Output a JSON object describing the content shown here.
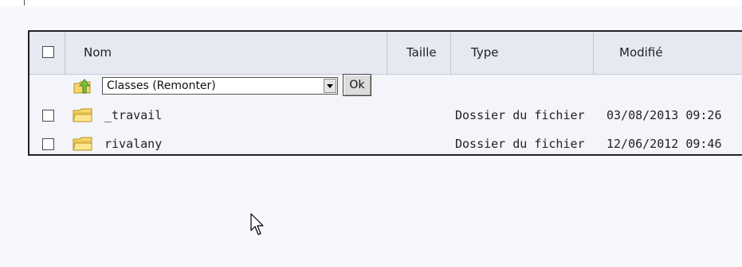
{
  "header": {
    "name_label": "Nom",
    "size_label": "Taille",
    "type_label": "Type",
    "modified_label": "Modifié"
  },
  "nav": {
    "up_icon": "folder-up-icon",
    "folder_select_value": "Classes (Remonter)",
    "ok_label": "Ok"
  },
  "files": [
    {
      "name": "_travail",
      "type": "Dossier du fichier",
      "modified": "03/08/2013 09:26",
      "icon": "folder-icon"
    },
    {
      "name": "rivalany",
      "type": "Dossier du fichier",
      "modified": "12/06/2012 09:46",
      "icon": "folder-icon"
    }
  ],
  "colors": {
    "header_bg": "#e6e8f2",
    "panel_bg": "#f4f5fb",
    "border": "#222222",
    "folder": "#f5d66a",
    "up_arrow": "#7cc043"
  }
}
